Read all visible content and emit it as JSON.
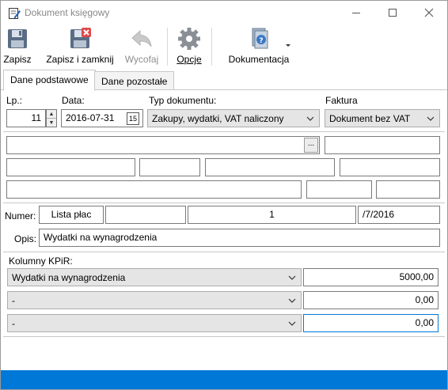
{
  "window": {
    "title": "Dokument księgowy"
  },
  "toolbar": {
    "save": "Zapisz",
    "save_close": "Zapisz i zamknij",
    "withdraw": "Wycofaj",
    "options": "Opcje",
    "documentation": "Dokumentacja"
  },
  "tabs": {
    "basic": "Dane podstawowe",
    "other": "Dane pozostałe"
  },
  "form": {
    "lp_label": "Lp.:",
    "lp_value": "11",
    "date_label": "Data:",
    "date_value": "2016-07-31",
    "doc_type_label": "Typ dokumentu:",
    "doc_type_value": "Zakupy, wydatki, VAT naliczony",
    "invoice_label": "Faktura",
    "invoice_value": "Dokument bez VAT",
    "dots": "...",
    "number_label": "Numer:",
    "number_parts": [
      "Lista płac",
      "",
      "1",
      "/7/2016"
    ],
    "desc_label": "Opis:",
    "desc_value": "Wydatki na wynagrodzenia",
    "kpir_label": "Kolumny KPiR:",
    "kpir_rows": [
      {
        "column": "Wydatki na wynagrodzenia",
        "amount": "5000,00"
      },
      {
        "column": "-",
        "amount": "0,00"
      },
      {
        "column": "-",
        "amount": "0,00"
      }
    ]
  }
}
